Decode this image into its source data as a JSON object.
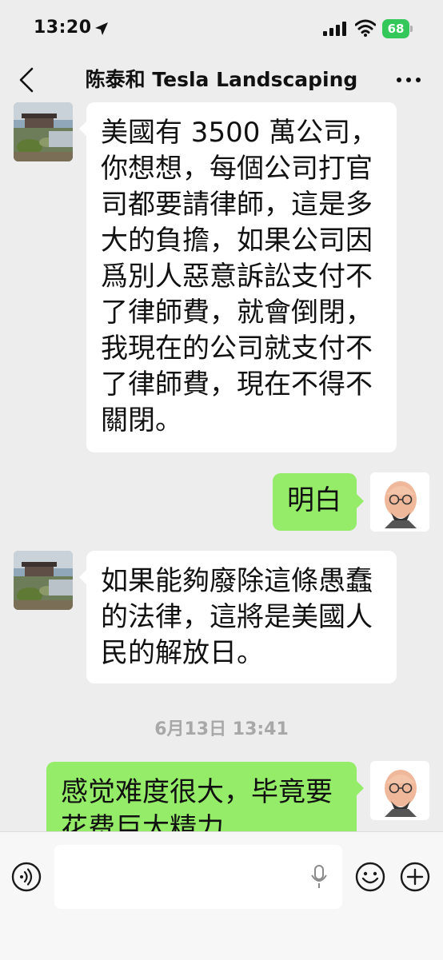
{
  "status_bar": {
    "time": "13:20",
    "battery": "68"
  },
  "header": {
    "title": "陈泰和 Tesla Landscaping"
  },
  "messages": [
    {
      "side": "in",
      "lines": [
        "美國有 3500 萬公司，",
        "你想想，每個公司打官",
        "司都要請律師，這是多",
        "大的負擔，如果公司因",
        "爲別人惡意訴訟支付不",
        "了律師費，就會倒閉，",
        "我現在的公司就支付不",
        "了律師費，現在不得不",
        "關閉。"
      ]
    },
    {
      "side": "out",
      "lines": [
        "明白"
      ]
    },
    {
      "side": "in",
      "lines": [
        "如果能夠廢除這條愚蠢",
        "的法律，這將是美國人",
        "民的解放日。"
      ]
    },
    {
      "side": "out",
      "lines": [
        "感觉难度很大，毕竟要",
        "花费巨大精力"
      ]
    }
  ],
  "timestamp": "6月13日 13:41",
  "colors": {
    "background": "#ededed",
    "incoming_bubble": "#ffffff",
    "outgoing_bubble": "#95ec69",
    "battery": "#34c759"
  },
  "icons": {
    "back": "chevron-left-icon",
    "more": "ellipsis-icon",
    "voice": "voice-icon",
    "mic": "mic-icon",
    "emoji": "emoji-icon",
    "plus": "plus-icon"
  }
}
